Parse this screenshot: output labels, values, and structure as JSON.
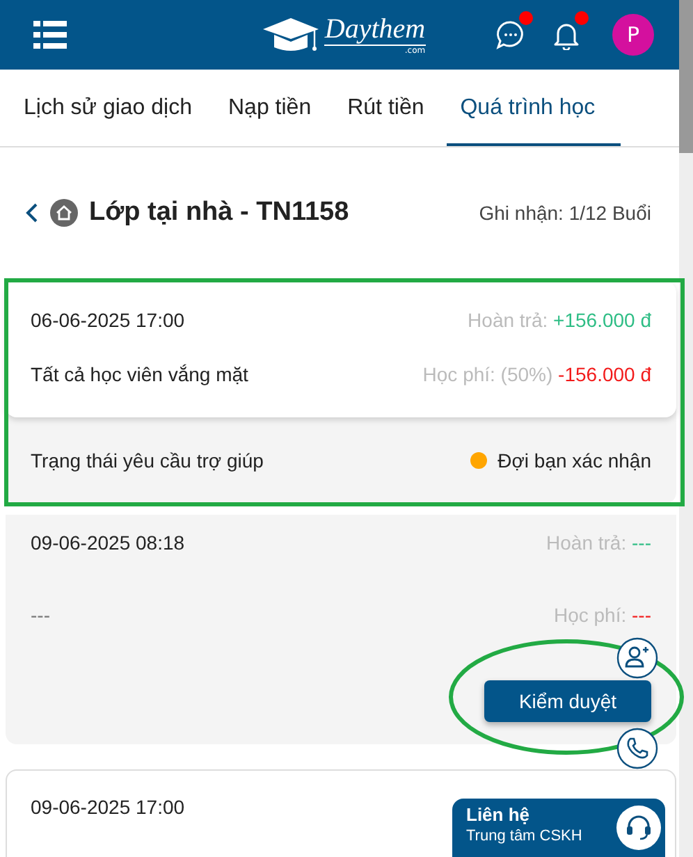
{
  "header": {
    "logo": {
      "name": "Daythem",
      "suffix": ".com"
    },
    "chat_unread": true,
    "notifications_unread": true,
    "avatar_letter": "P"
  },
  "tabs": [
    {
      "label": "Lịch sử giao dịch",
      "selected": false
    },
    {
      "label": "Nạp tiền",
      "selected": false
    },
    {
      "label": "Rút tiền",
      "selected": false
    },
    {
      "label": "Quá trình học",
      "selected": true
    }
  ],
  "class_header": {
    "title": "Lớp tại nhà - TN1158",
    "record": "Ghi nhận: 1/12 Buổi"
  },
  "sessions": [
    {
      "kind": "raised",
      "datetime": "06-06-2025 17:00",
      "note": "Tất cả học viên vắng mặt",
      "refund_label": "Hoàn trả:",
      "refund_value": "+156.000 đ",
      "fee_label": "Học phí: (50%)",
      "fee_value": "-156.000 đ",
      "help_status": {
        "label": "Trạng thái yêu cầu trợ giúp",
        "value": "Đợi bạn xác nhận",
        "color": "#ffa500"
      },
      "highlight": {
        "kind": "rectangle"
      }
    },
    {
      "kind": "muted",
      "datetime": "09-06-2025 08:18",
      "note": "---",
      "refund_label": "Hoàn trả:",
      "refund_value": "---",
      "fee_label": "Học phí:",
      "fee_value": "---",
      "action": "Kiểm duyệt",
      "highlight": {
        "kind": "ellipse"
      }
    },
    {
      "kind": "outlined",
      "datetime": "09-06-2025 17:00"
    }
  ],
  "contact": {
    "title": "Liên hệ",
    "subtitle": "Trung tâm CSKH"
  }
}
